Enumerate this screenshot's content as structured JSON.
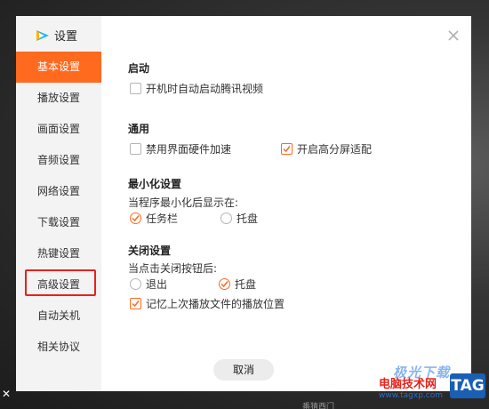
{
  "app": {
    "title": "设置",
    "logo_icon": "tencent-video-logo-icon"
  },
  "sidebar": {
    "items": [
      {
        "label": "基本设置",
        "active": true
      },
      {
        "label": "播放设置",
        "active": false
      },
      {
        "label": "画面设置",
        "active": false
      },
      {
        "label": "音频设置",
        "active": false
      },
      {
        "label": "网络设置",
        "active": false
      },
      {
        "label": "下载设置",
        "active": false
      },
      {
        "label": "热键设置",
        "active": false
      },
      {
        "label": "高级设置",
        "active": false,
        "highlighted": true
      },
      {
        "label": "自动关机",
        "active": false
      },
      {
        "label": "相关协议",
        "active": false
      }
    ]
  },
  "sections": {
    "startup": {
      "title": "启动",
      "options": [
        {
          "label": "开机时自动启动腾讯视频",
          "checked": false
        }
      ]
    },
    "general": {
      "title": "通用",
      "options": [
        {
          "label": "禁用界面硬件加速",
          "checked": false
        },
        {
          "label": "开启高分屏适配",
          "checked": true
        }
      ]
    },
    "minimize": {
      "title": "最小化设置",
      "prompt": "当程序最小化后显示在:",
      "options": [
        {
          "label": "任务栏",
          "selected": true
        },
        {
          "label": "托盘",
          "selected": false
        }
      ]
    },
    "close": {
      "title": "关闭设置",
      "prompt": "当点击关闭按钮后:",
      "options": [
        {
          "label": "退出",
          "selected": false
        },
        {
          "label": "托盘",
          "selected": true
        }
      ],
      "remember": {
        "label": "记忆上次播放文件的播放位置",
        "checked": true
      }
    }
  },
  "footer": {
    "cancel_label": "取消"
  },
  "watermark": {
    "top": "极光下载",
    "site": "电脑技术网",
    "url": "www.tagxp.com",
    "badge": "TAG"
  },
  "background": {
    "caption": "番猜西门"
  },
  "colors": {
    "accent": "#ff6a1f",
    "highlight": "#e8211b",
    "sidebar_bg": "#f3f3f3"
  }
}
